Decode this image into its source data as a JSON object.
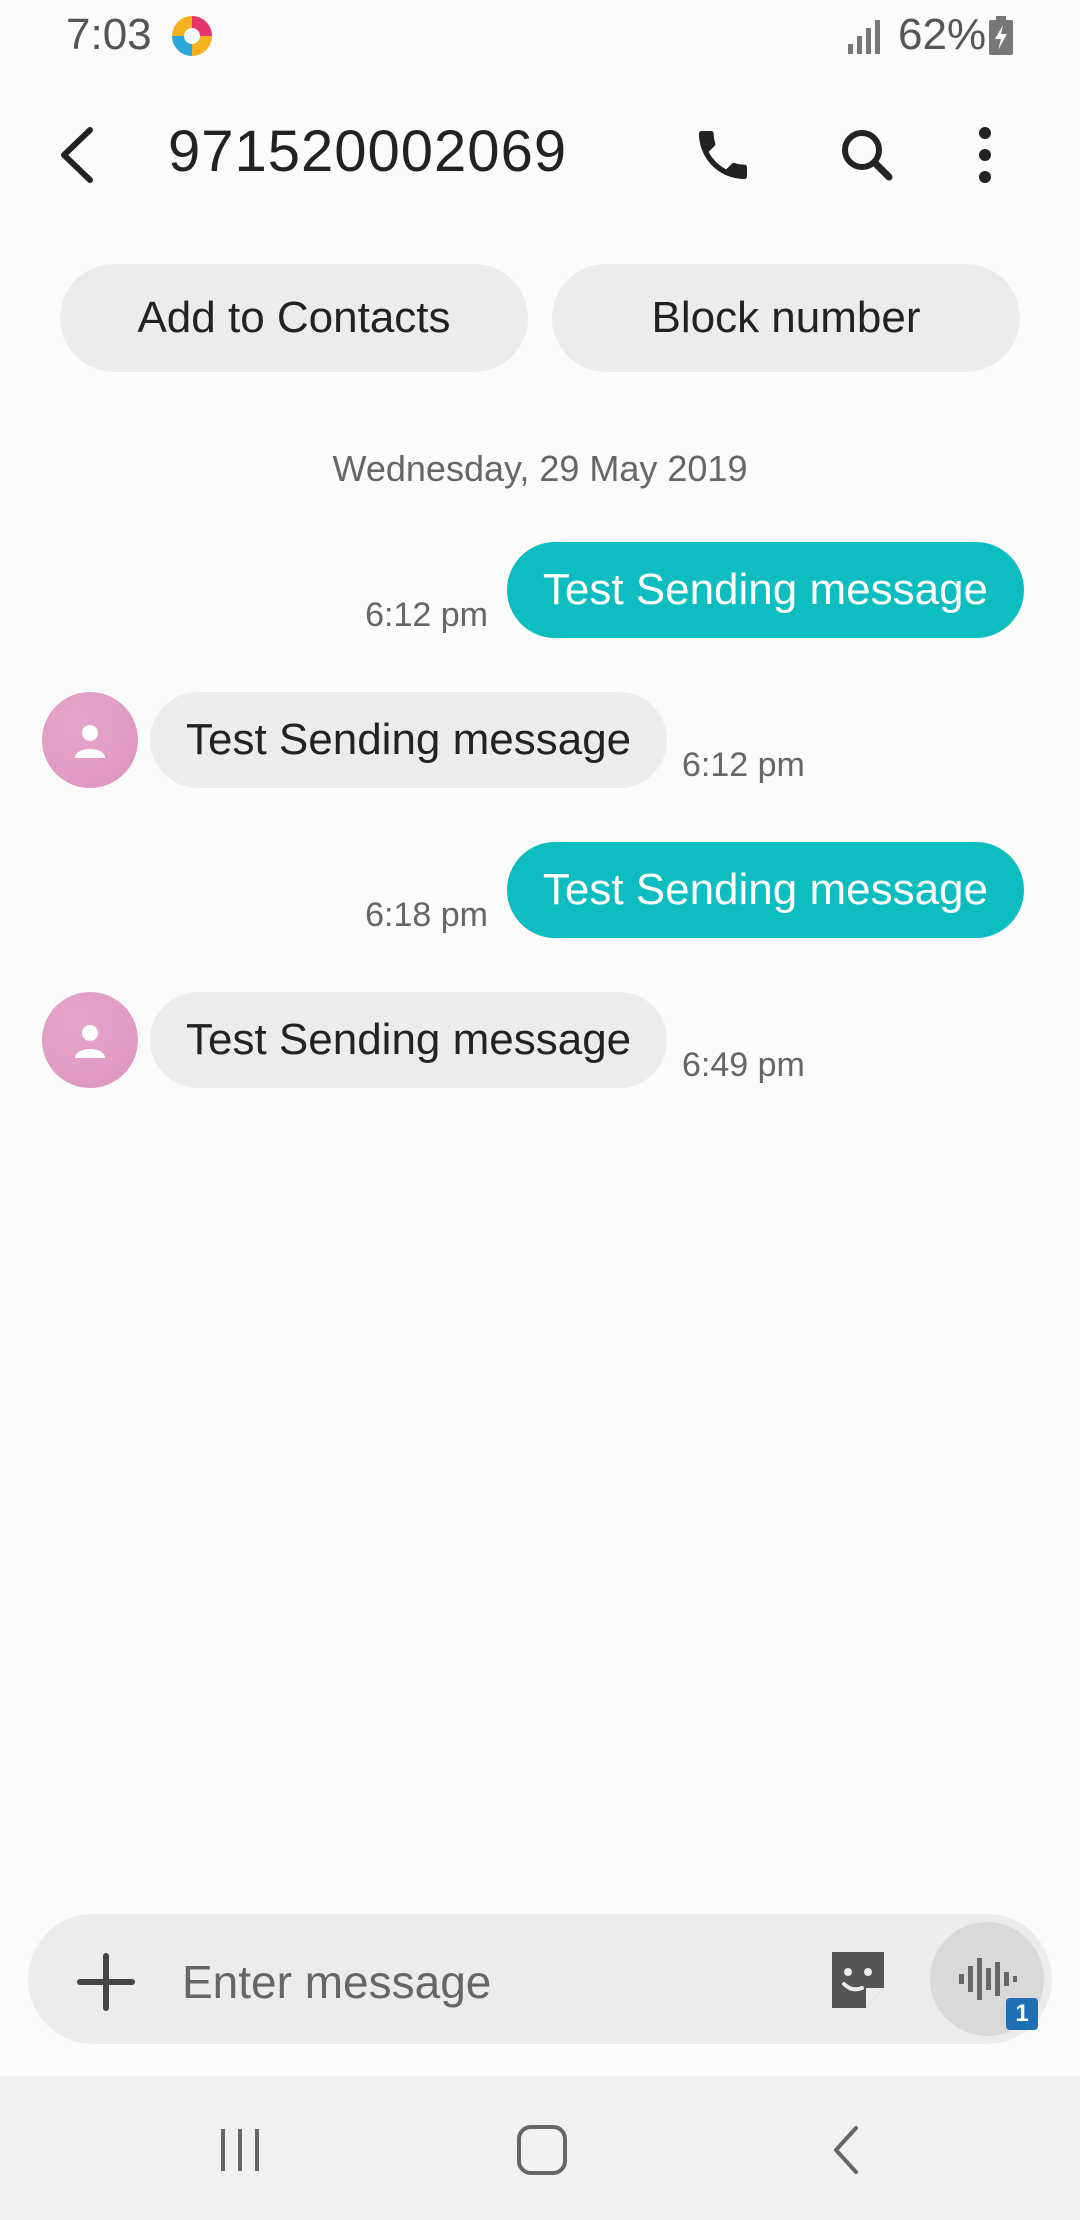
{
  "status_bar": {
    "time": "7:03",
    "battery": "62%",
    "icons": [
      "browser-app-icon",
      "signal-icon",
      "battery-charging-icon"
    ]
  },
  "header": {
    "title": "971520002069",
    "icons": [
      "back-icon",
      "phone-icon",
      "search-icon",
      "more-vert-icon"
    ]
  },
  "actions": {
    "add_contact": "Add to Contacts",
    "block": "Block number"
  },
  "date_separator": "Wednesday, 29 May 2019",
  "messages": [
    {
      "direction": "out",
      "text": "Test Sending message",
      "time": "6:12 pm"
    },
    {
      "direction": "in",
      "text": "Test Sending message",
      "time": "6:12 pm"
    },
    {
      "direction": "out",
      "text": "Test Sending message",
      "time": "6:18 pm"
    },
    {
      "direction": "in",
      "text": "Test Sending message",
      "time": "6:49 pm"
    }
  ],
  "composer": {
    "placeholder": "Enter message",
    "voice_badge": "1",
    "icons": [
      "add-icon",
      "sticker-icon",
      "voice-icon"
    ]
  },
  "nav": {
    "icons": [
      "recents-icon",
      "home-icon",
      "back-icon"
    ]
  },
  "colors": {
    "accent": "#0ebdbf",
    "incoming_bubble": "#ececec",
    "avatar": "#db94bf",
    "badge": "#1e6fb3"
  }
}
